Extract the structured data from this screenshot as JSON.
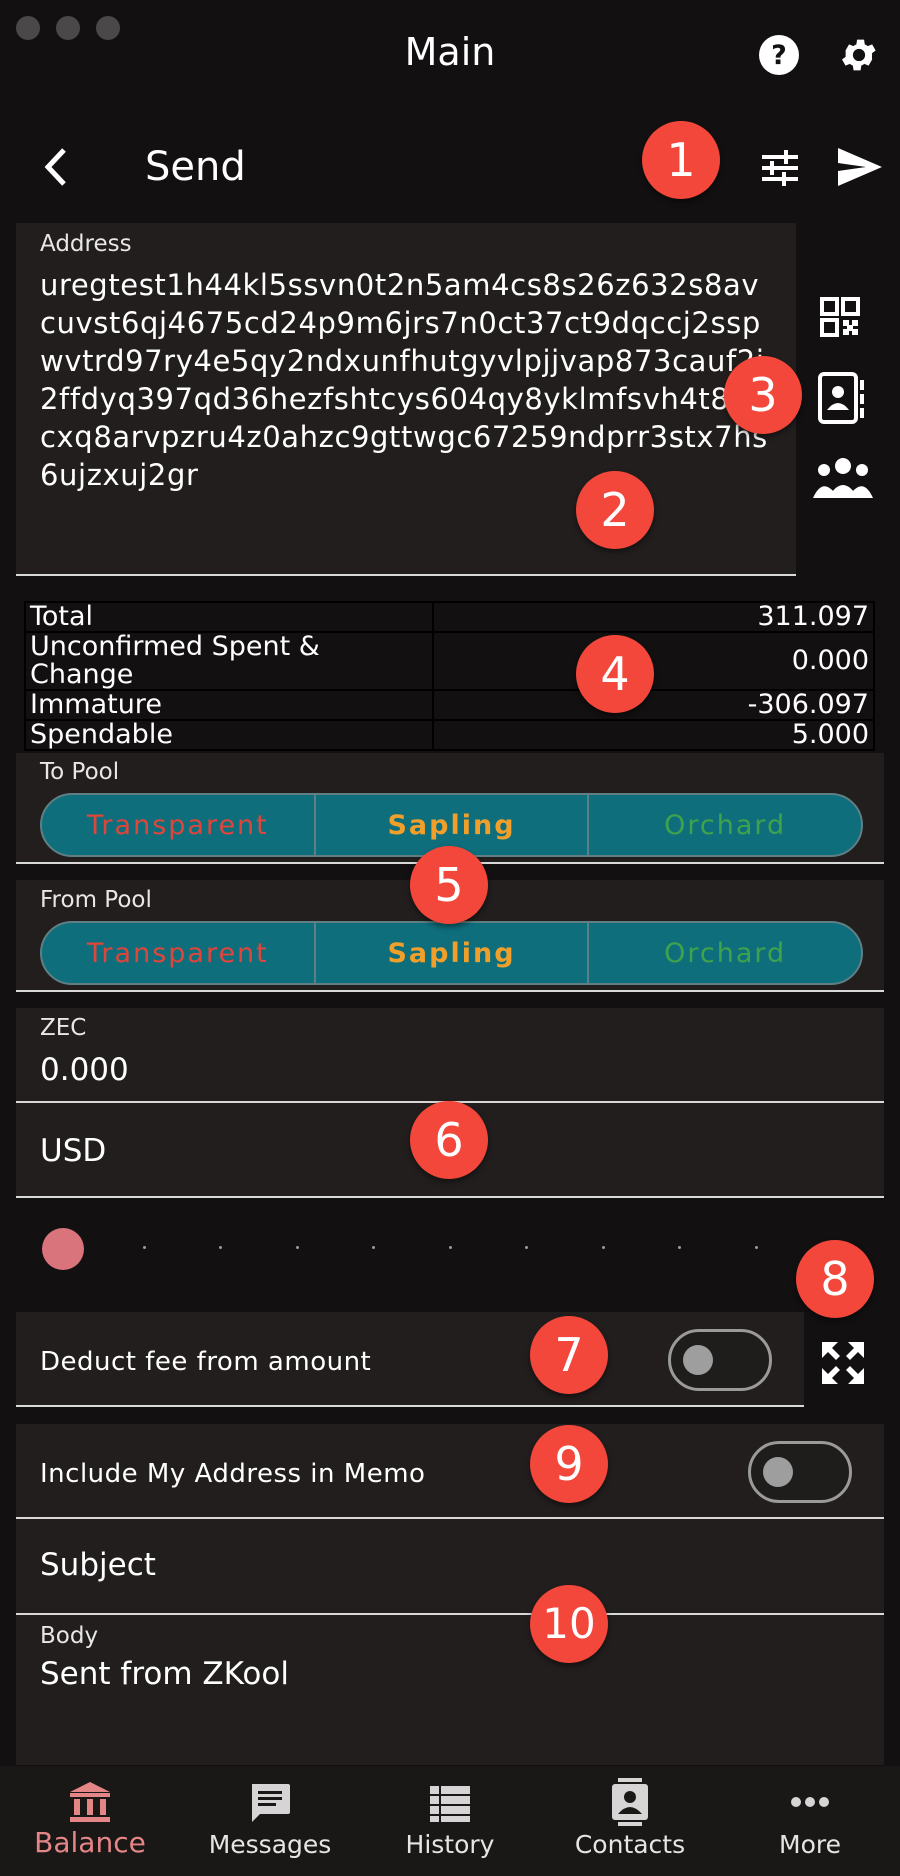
{
  "window": {
    "title": "Main"
  },
  "header": {
    "title": "Send"
  },
  "address": {
    "label": "Address",
    "value": "uregtest1h44kl5ssvn0t2n5am4cs8s26z632s8avcuvst6qj4675cd24p9m6jrs7n0ct37ct9dqccj2sspwvtrd97ry4e5qy2ndxunfhutgyvlpjjvap873cauf2j2ffdyq397qd36hezfshtcys604qy8yklmfsvh4t8wcxq8arvpzru4z0ahzc9gttwgc67259ndprr3stx7hs6ujzxuj2gr"
  },
  "balances": [
    {
      "label": "Total",
      "value": "311.097"
    },
    {
      "label": "Unconfirmed Spent & Change",
      "value": "0.000"
    },
    {
      "label": "Immature",
      "value": "-306.097"
    },
    {
      "label": "Spendable",
      "value": "5.000"
    }
  ],
  "to_pool": {
    "label": "To Pool",
    "options": [
      "Transparent",
      "Sapling",
      "Orchard"
    ]
  },
  "from_pool": {
    "label": "From Pool",
    "options": [
      "Transparent",
      "Sapling",
      "Orchard"
    ]
  },
  "pool_colors": {
    "transparent": "#e0453b",
    "sapling": "#f0a02a",
    "orchard": "#3fa34d"
  },
  "amount": {
    "zec_label": "ZEC",
    "zec_value": "0.000",
    "usd_placeholder": "USD"
  },
  "slider": {
    "value_fraction": 0,
    "thumb_color": "#d9747c"
  },
  "deduct_fee": {
    "label": "Deduct fee from amount",
    "on": false
  },
  "memo": {
    "include_address_label": "Include My Address in Memo",
    "include_on": false,
    "subject_placeholder": "Subject",
    "body_label": "Body",
    "body_value": "Sent from ZKool"
  },
  "badges": [
    "1",
    "2",
    "3",
    "4",
    "5",
    "6",
    "7",
    "8",
    "9",
    "10"
  ],
  "nav": [
    {
      "label": "Balance",
      "icon": "bank-icon",
      "active": true
    },
    {
      "label": "Messages",
      "icon": "message-icon",
      "active": false
    },
    {
      "label": "History",
      "icon": "list-icon",
      "active": false
    },
    {
      "label": "Contacts",
      "icon": "contact-card-icon",
      "active": false
    },
    {
      "label": "More",
      "icon": "more-dots-icon",
      "active": false
    }
  ],
  "colors": {
    "accent": "#f2473a",
    "active_nav": "#e58686",
    "segment_bg": "#0e6e7c",
    "background": "#121010"
  }
}
